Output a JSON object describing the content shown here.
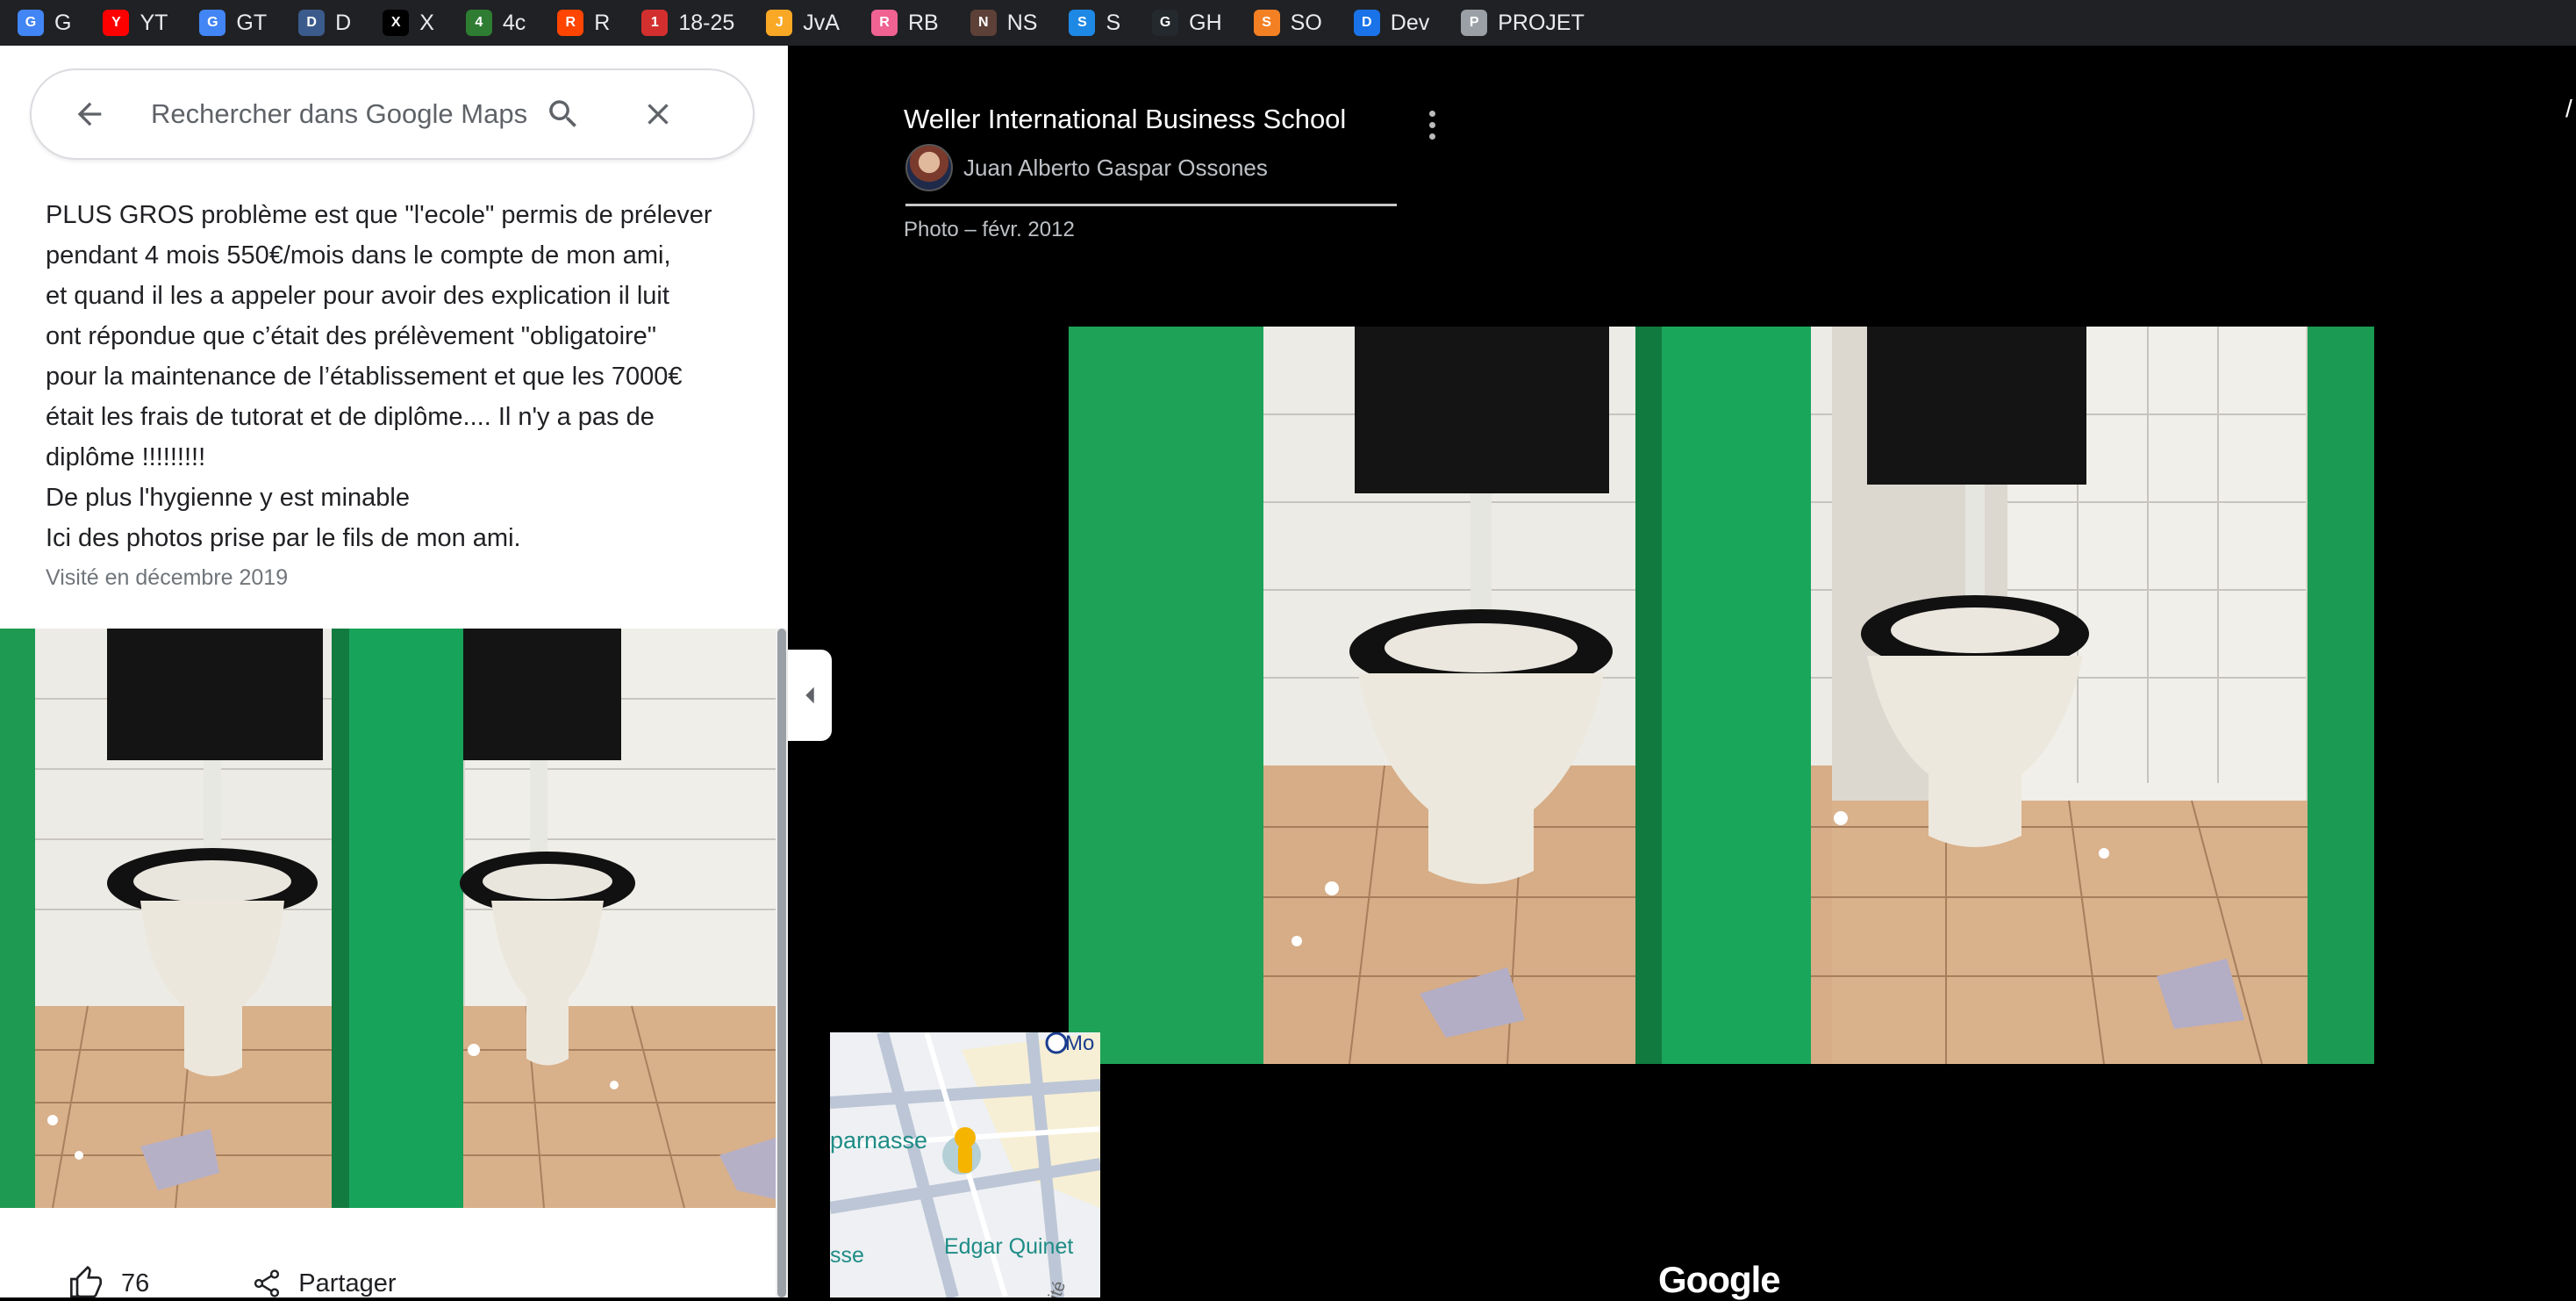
{
  "bookmarks": [
    {
      "label": "G",
      "icon": "google-icon",
      "color": "#4285f4"
    },
    {
      "label": "YT",
      "icon": "youtube-icon",
      "color": "#ff0000"
    },
    {
      "label": "GT",
      "icon": "translate-icon",
      "color": "#4285f4"
    },
    {
      "label": "D",
      "icon": "devtools-icon",
      "color": "#3b5b8c"
    },
    {
      "label": "X",
      "icon": "x-icon",
      "color": "#000000"
    },
    {
      "label": "4c",
      "icon": "fourchan-icon",
      "color": "#2e7d32"
    },
    {
      "label": "R",
      "icon": "reddit-icon",
      "color": "#ff4500"
    },
    {
      "label": "18-25",
      "icon": "jvc-icon",
      "color": "#d32f2f"
    },
    {
      "label": "JvA",
      "icon": "jva-icon",
      "color": "#f9a825"
    },
    {
      "label": "RB",
      "icon": "rb-icon",
      "color": "#f06292"
    },
    {
      "label": "NS",
      "icon": "ns-icon",
      "color": "#5d4037"
    },
    {
      "label": "S",
      "icon": "s-icon",
      "color": "#1e88e5"
    },
    {
      "label": "GH",
      "icon": "github-icon",
      "color": "#24292e"
    },
    {
      "label": "SO",
      "icon": "stackoverflow-icon",
      "color": "#f48024"
    },
    {
      "label": "Dev",
      "icon": "dev-icon",
      "color": "#1a73e8"
    },
    {
      "label": "PROJET",
      "icon": "folder-icon",
      "color": "#9aa0a6"
    }
  ],
  "search": {
    "placeholder": "Rechercher dans Google Maps"
  },
  "review": {
    "lines": [
      "PLUS GROS problème est que \"l'ecole\" permis de prélever",
      "pendant 4 mois 550€/mois dans le compte de mon ami,",
      "et quand il les a appeler pour avoir des explication il luit",
      "ont répondue que c’était des prélèvement \"obligatoire\"",
      "pour la maintenance de l’établissement et que les 7000€",
      "était les frais de tutorat et de diplôme.... Il n'y a pas de",
      "diplôme !!!!!!!!!",
      "De plus l'hygienne y est minable",
      "Ici des photos prise par le fils de mon ami."
    ],
    "visited": "Visité en décembre 2019",
    "likes": "76",
    "share_label": "Partager"
  },
  "viewer": {
    "title": "Weller International Business School",
    "author": "Juan Alberto Gaspar Ossones",
    "photo_date": "Photo – févr. 2012",
    "brand": "Google"
  },
  "minimap": {
    "label_1": "parnasse",
    "label_2": "Edgar Quinet",
    "label_3": "sse",
    "label_4": "Mo",
    "label_5": "ité"
  }
}
